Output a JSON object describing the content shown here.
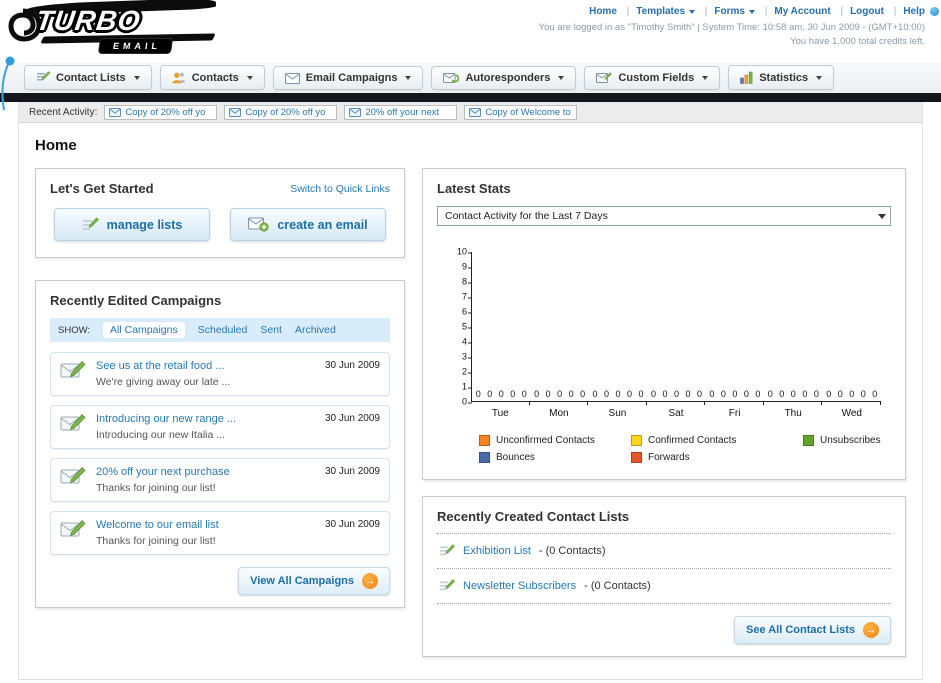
{
  "header": {
    "logo_text": "TURBO",
    "logo_sub": "EMAIL",
    "nav": {
      "home": "Home",
      "templates": "Templates",
      "forms": "Forms",
      "my_account": "My Account",
      "logout": "Logout",
      "help": "Help"
    },
    "login_info": "You are logged in as \"Timothy Smith\" | System Time: 10:58 am, 30 Jun 2009 - (GMT+10:00)",
    "credits_info": "You have 1,000 total credits left."
  },
  "nav_tabs": [
    {
      "label": "Contact Lists"
    },
    {
      "label": "Contacts"
    },
    {
      "label": "Email Campaigns"
    },
    {
      "label": "Autoresponders"
    },
    {
      "label": "Custom Fields"
    },
    {
      "label": "Statistics"
    }
  ],
  "activity_bar": {
    "label": "Recent Activity:",
    "items": [
      "Copy of 20% off yo",
      "Copy of 20% off yo",
      "20% off your next",
      "Copy of Welcome to"
    ]
  },
  "page_title": "Home",
  "get_started": {
    "title": "Let's Get Started",
    "switch_link": "Switch to Quick Links",
    "manage_lists_button": "manage lists",
    "create_email_button": "create an email"
  },
  "campaigns": {
    "title": "Recently Edited Campaigns",
    "show_label": "SHOW:",
    "filter_tabs": [
      "All Campaigns",
      "Scheduled",
      "Sent",
      "Archived"
    ],
    "items": [
      {
        "title": "See us at the retail food ...",
        "subtitle": "We're giving away our late ...",
        "date": "30 Jun 2009"
      },
      {
        "title": "Introducing our new range ...",
        "subtitle": "Introducing our new Italia ...",
        "date": "30 Jun 2009"
      },
      {
        "title": "20% off your next purchase",
        "subtitle": "Thanks for joining our list!",
        "date": "30 Jun 2009"
      },
      {
        "title": "Welcome to our email list",
        "subtitle": "Thanks for joining our list!",
        "date": "30 Jun 2009"
      }
    ],
    "view_all_button": "View All Campaigns"
  },
  "stats": {
    "title": "Latest Stats",
    "dropdown_value": "Contact Activity for the Last 7 Days"
  },
  "chart_data": {
    "type": "bar",
    "title": "Contact Activity for the Last 7 Days",
    "categories": [
      "Tue",
      "Mon",
      "Sun",
      "Sat",
      "Fri",
      "Thu",
      "Wed"
    ],
    "series": [
      {
        "name": "Unconfirmed Contacts",
        "color": "#f5821f",
        "values": [
          0,
          0,
          0,
          0,
          0,
          0,
          0
        ]
      },
      {
        "name": "Confirmed Contacts",
        "color": "#ffd51e",
        "values": [
          0,
          0,
          0,
          0,
          0,
          0,
          0
        ]
      },
      {
        "name": "Unsubscribes",
        "color": "#64a22e",
        "values": [
          0,
          0,
          0,
          0,
          0,
          0,
          0
        ]
      },
      {
        "name": "Bounces",
        "color": "#4b6cab",
        "values": [
          0,
          0,
          0,
          0,
          0,
          0,
          0
        ]
      },
      {
        "name": "Forwards",
        "color": "#e5562a",
        "values": [
          0,
          0,
          0,
          0,
          0,
          0,
          0
        ]
      }
    ],
    "ylim": [
      0,
      10
    ],
    "ytick_step": 1,
    "grid": false,
    "legend_position": "bottom"
  },
  "contact_lists": {
    "title": "Recently Created Contact Lists",
    "items": [
      {
        "name": "Exhibition List",
        "detail": " - (0 Contacts)"
      },
      {
        "name": "Newsletter Subscribers",
        "detail": " - (0 Contacts)"
      }
    ],
    "see_all_button": "See All Contact Lists"
  }
}
